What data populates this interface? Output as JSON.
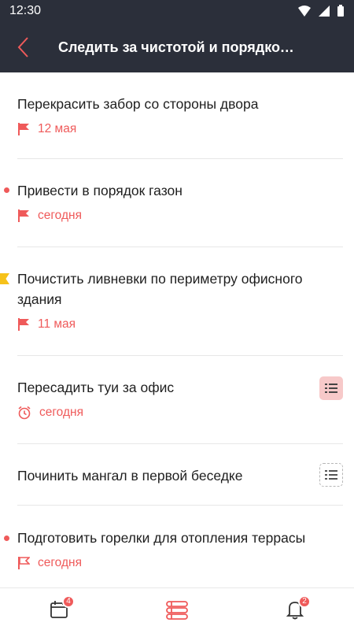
{
  "status_bar": {
    "time": "12:30"
  },
  "app_bar": {
    "title": "Следить за чистотой и порядком..."
  },
  "tasks": [
    {
      "title": "Перекрасить забор со стороны двора",
      "date": "12 мая"
    },
    {
      "title": "Привести в порядок газон",
      "date": "сегодня"
    },
    {
      "title": "Почистить ливневки по периметру офисного здания",
      "date": "11 мая"
    },
    {
      "title": "Пересадить туи за офис",
      "date": "сегодня"
    },
    {
      "title": "Починить мангал в первой беседке"
    },
    {
      "title": "Подготовить горелки для отопления террасы",
      "date": "сегодня"
    }
  ],
  "bottom_nav": {
    "calendar_badge": "4",
    "notifications_badge": "2"
  },
  "colors": {
    "appbar": "#2b2f3a",
    "accent": "#ef5a5a",
    "bookmark": "#f6c21a"
  }
}
